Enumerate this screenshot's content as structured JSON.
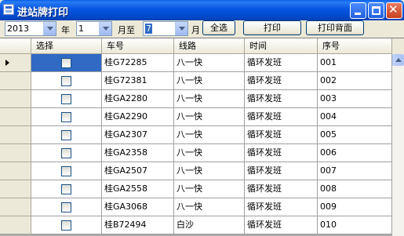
{
  "window": {
    "title": "进站牌打印"
  },
  "toolbar": {
    "year_value": "2013",
    "year_label": "年",
    "month_from_value": "1",
    "month_to_label": "月至",
    "month_to_value": "7",
    "month_label": "月",
    "select_all_label": "全选",
    "print_label": "打印",
    "print_back_label": "打印背面"
  },
  "grid": {
    "columns": [
      "选择",
      "车号",
      "线路",
      "时间",
      "序号"
    ],
    "rows": [
      {
        "plate": "桂G72285",
        "route": "八一快",
        "time": "循环发班",
        "seq": "001"
      },
      {
        "plate": "桂G72381",
        "route": "八一快",
        "time": "循环发班",
        "seq": "002"
      },
      {
        "plate": "桂GA2280",
        "route": "八一快",
        "time": "循环发班",
        "seq": "003"
      },
      {
        "plate": "桂GA2290",
        "route": "八一快",
        "time": "循环发班",
        "seq": "004"
      },
      {
        "plate": "桂GA2307",
        "route": "八一快",
        "time": "循环发班",
        "seq": "005"
      },
      {
        "plate": "桂GA2358",
        "route": "八一快",
        "time": "循环发班",
        "seq": "006"
      },
      {
        "plate": "桂GA2507",
        "route": "八一快",
        "time": "循环发班",
        "seq": "007"
      },
      {
        "plate": "桂GA2558",
        "route": "八一快",
        "time": "循环发班",
        "seq": "008"
      },
      {
        "plate": "桂GA3068",
        "route": "八一快",
        "time": "循环发班",
        "seq": "009"
      },
      {
        "plate": "桂B72494",
        "route": "白沙",
        "time": "循环发班",
        "seq": "010"
      }
    ]
  }
}
